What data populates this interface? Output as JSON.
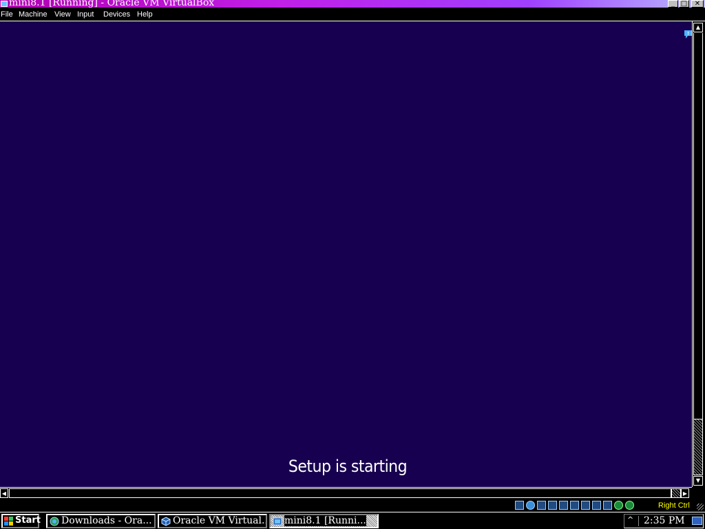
{
  "window": {
    "title": "mini8.1 [Running] - Oracle VM VirtualBox",
    "minimize": "_",
    "maximize": "□",
    "close": "✕"
  },
  "menu": {
    "items": [
      "File",
      "Machine",
      "View",
      "Input",
      "Devices",
      "Help"
    ]
  },
  "vm_screen": {
    "message": "Setup is starting",
    "background_color": "#17004f"
  },
  "status_bar": {
    "host_key": "Right Ctrl",
    "icons": [
      "hard-disk-icon",
      "optical-drive-icon",
      "audio-icon",
      "network-icon",
      "usb-icon",
      "shared-folders-icon",
      "display-icon",
      "video-capture-icon",
      "virtualization-icon",
      "mouse-integration-icon",
      "keyboard-capture-icon"
    ]
  },
  "taskbar": {
    "start_label": "Start",
    "buttons": [
      {
        "label": "Downloads - Ora...",
        "icon": "browser-icon",
        "active": false
      },
      {
        "label": "Oracle VM Virtual...",
        "icon": "virtualbox-icon",
        "active": false
      },
      {
        "label": "mini8.1 [Runni...",
        "icon": "vm-window-icon",
        "active": true
      }
    ],
    "tray_chevron": "^",
    "clock": "2:35 PM"
  }
}
